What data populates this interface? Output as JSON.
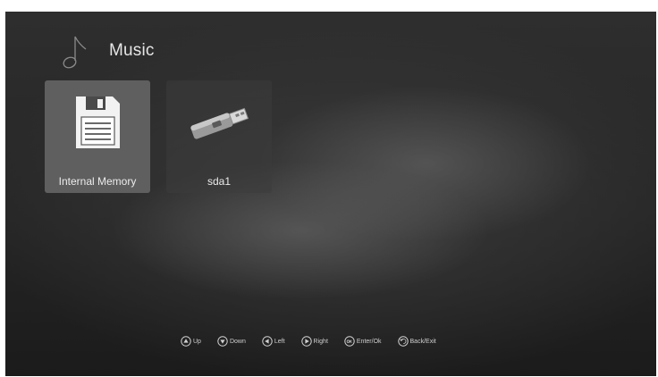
{
  "header": {
    "title": "Music",
    "icon": "music-note-icon"
  },
  "devices": [
    {
      "label": "Internal Memory",
      "icon": "floppy-disk-icon",
      "selected": true
    },
    {
      "label": "sda1",
      "icon": "usb-drive-icon",
      "selected": false
    }
  ],
  "hints": [
    {
      "icon": "up-arrow-icon",
      "label": "Up"
    },
    {
      "icon": "down-arrow-icon",
      "label": "Down"
    },
    {
      "icon": "left-arrow-icon",
      "label": "Left"
    },
    {
      "icon": "right-arrow-icon",
      "label": "Right"
    },
    {
      "icon": "ok-icon",
      "label": "Enter/Ok"
    },
    {
      "icon": "back-icon",
      "label": "Back/Exit"
    }
  ],
  "colors": {
    "tile_selected": "#5f5f5f",
    "text": "#e6e6e6"
  }
}
